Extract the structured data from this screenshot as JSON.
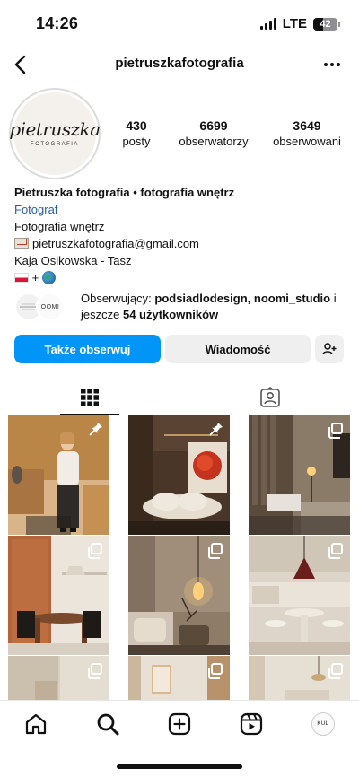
{
  "status_bar": {
    "time": "14:26",
    "network": "LTE",
    "battery": "42",
    "battery_level": 0.42
  },
  "header": {
    "username": "pietruszkafotografia"
  },
  "avatar": {
    "logo_text": "pietruszka",
    "logo_sub": "FOTOGRAFIA"
  },
  "stats": [
    {
      "value": "430",
      "label": "posty"
    },
    {
      "value": "6699",
      "label": "obserwatorzy"
    },
    {
      "value": "3649",
      "label": "obserwowani"
    }
  ],
  "bio": {
    "name": "Pietruszka fotografia • fotografia wnętrz",
    "category": "Fotograf",
    "line1": "Fotografia wnętrz",
    "email": "pietruszkafotografia@gmail.com",
    "line3": "Kaja Osikowska - Tasz",
    "plus": "+"
  },
  "followed_by": {
    "prefix": "Obserwujący: ",
    "names": "podsiadlodesign, noomi_studio",
    "suffix_pre": " i jeszcze ",
    "count_text": "54 użytkowników",
    "mini_avatar_2": "OOMI"
  },
  "buttons": {
    "follow": "Także obserwuj",
    "message": "Wiadomość"
  },
  "bottom_nav": {
    "profile_text": "KUL"
  },
  "icons": [
    "back-icon",
    "more-icon",
    "grid-icon",
    "tagged-icon",
    "add-user-icon",
    "pin-icon",
    "multi-photo-icon",
    "home-icon",
    "search-icon",
    "create-icon",
    "reels-icon"
  ]
}
